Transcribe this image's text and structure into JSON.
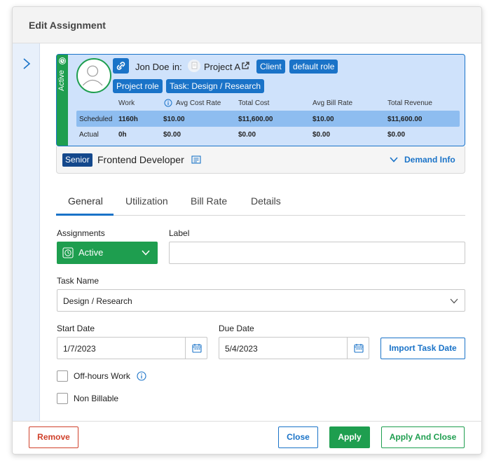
{
  "modal": {
    "title": "Edit Assignment"
  },
  "card": {
    "status": "Active",
    "person_name": "Jon Doe",
    "in_label": "in:",
    "project_name": "Project A",
    "tags": [
      "Client",
      "default role",
      "Project role",
      "Task: Design / Research"
    ],
    "table": {
      "headers": [
        "Work",
        "Avg Cost Rate",
        "Total Cost",
        "Avg Bill Rate",
        "Total Revenue"
      ],
      "rows": [
        {
          "label": "Scheduled",
          "work": "1160h",
          "avg_cost_rate": "$10.00",
          "total_cost": "$11,600.00",
          "avg_bill_rate": "$10.00",
          "total_revenue": "$11,600.00"
        },
        {
          "label": "Actual",
          "work": "0h",
          "avg_cost_rate": "$0.00",
          "total_cost": "$0.00",
          "avg_bill_rate": "$0.00",
          "total_revenue": "$0.00"
        }
      ]
    }
  },
  "role_bar": {
    "seniority": "Senior",
    "role": "Frontend Developer",
    "demand_info": "Demand Info"
  },
  "tabs": [
    "General",
    "Utilization",
    "Bill Rate",
    "Details"
  ],
  "form": {
    "assignments_label": "Assignments",
    "assignments_value": "Active",
    "label_label": "Label",
    "label_value": "",
    "task_name_label": "Task Name",
    "task_name_value": "Design / Research",
    "start_date_label": "Start Date",
    "start_date_value": "1/7/2023",
    "due_date_label": "Due Date",
    "due_date_value": "5/4/2023",
    "import_task_date": "Import Task Date",
    "off_hours_label": "Off-hours Work",
    "non_billable_label": "Non Billable"
  },
  "footer": {
    "remove": "Remove",
    "close": "Close",
    "apply": "Apply",
    "apply_and_close": "Apply And Close"
  },
  "colors": {
    "primary": "#1a73c8",
    "success": "#1e9e4f",
    "danger": "#d0412b",
    "card_bg": "#cfe2fb",
    "highlight_row": "#8ebdf0",
    "senior_tag": "#14488c"
  },
  "icons": [
    "chevron-right-icon",
    "clock-icon",
    "user-avatar-icon",
    "link-icon",
    "project-icon",
    "external-link-icon",
    "info-icon",
    "document-icon",
    "chevron-down-icon",
    "calendar-icon"
  ]
}
